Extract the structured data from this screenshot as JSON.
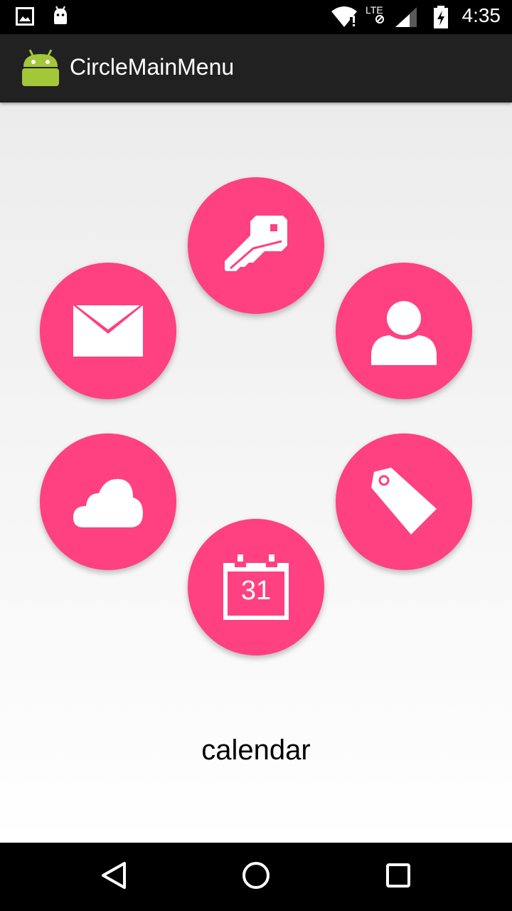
{
  "status_bar": {
    "time": "4:35",
    "network_label": "LTE",
    "icons": [
      "gallery-icon",
      "android-notification-icon",
      "wifi-icon",
      "lte-signal-icon",
      "battery-charging-icon"
    ]
  },
  "action_bar": {
    "title": "CircleMainMenu",
    "icon": "android-app-icon"
  },
  "menu": {
    "accent_color": "#ff4081",
    "items": [
      {
        "name": "key",
        "icon": "key-icon"
      },
      {
        "name": "mail",
        "icon": "mail-icon"
      },
      {
        "name": "person",
        "icon": "person-icon"
      },
      {
        "name": "cloud",
        "icon": "cloud-icon"
      },
      {
        "name": "tag",
        "icon": "tag-icon"
      },
      {
        "name": "calendar",
        "icon": "calendar-icon",
        "day": "31"
      }
    ],
    "selected_label": "calendar"
  },
  "nav_bar": {
    "buttons": [
      "back",
      "home",
      "recents"
    ]
  }
}
